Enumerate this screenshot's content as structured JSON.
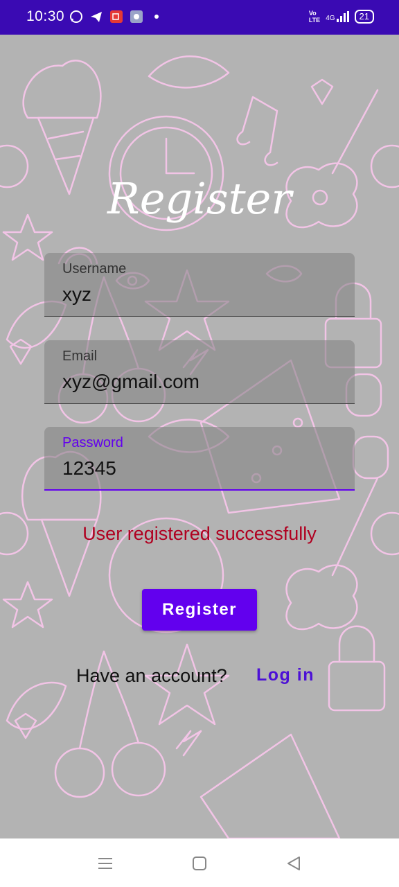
{
  "status_bar": {
    "time": "10:30",
    "left_icons": [
      "whatsapp-icon",
      "telegram-icon",
      "screen-recorder-icon",
      "settings-app-icon",
      "dot-icon"
    ],
    "right_icons": [
      "volte-icon",
      "4g-signal-icon",
      "battery-icon"
    ],
    "battery": "21",
    "network": "4G"
  },
  "page": {
    "title": "Register"
  },
  "form": {
    "username": {
      "label": "Username",
      "value": "xyz"
    },
    "email": {
      "label": "Email",
      "value": "xyz@gmail.com"
    },
    "password": {
      "label": "Password",
      "value": "12345"
    }
  },
  "message": "User registered successfully",
  "actions": {
    "register_label": "Register",
    "have_account_text": "Have an account?",
    "login_label": "Log in"
  },
  "nav_bar": {
    "icons": [
      "recent-apps-icon",
      "home-icon",
      "back-icon"
    ]
  },
  "colors": {
    "accent": "#6200ee",
    "status_bar": "#3a0ab3",
    "success_text": "#b00020",
    "background": "#b3b3b3",
    "doodle": "#f2c4e6"
  }
}
